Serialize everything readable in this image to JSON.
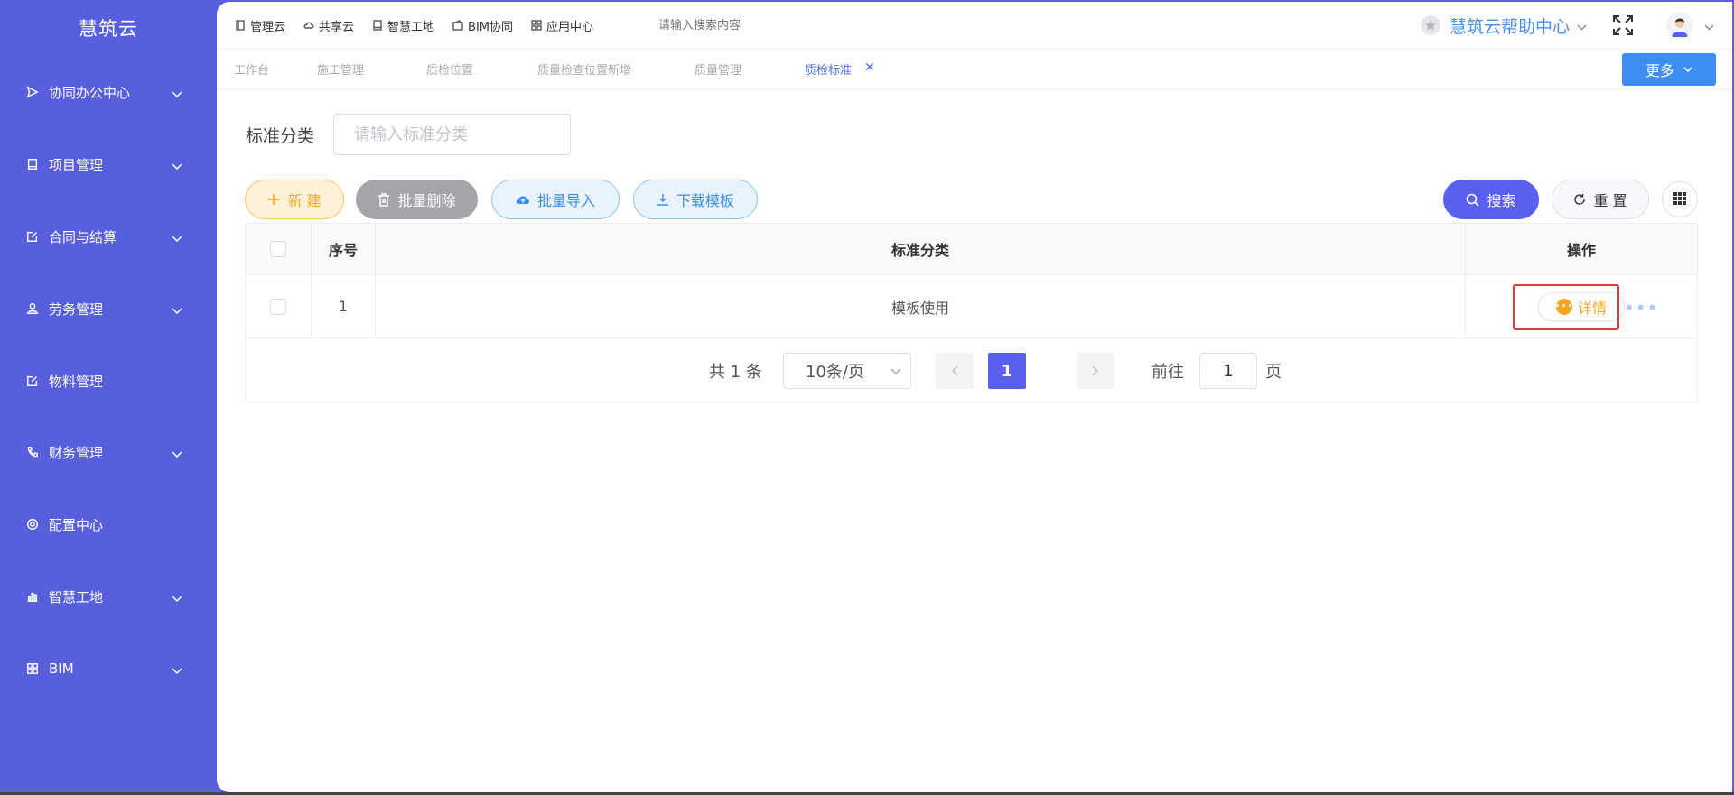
{
  "sidebar": {
    "logo": "慧筑云",
    "items": [
      {
        "label": "协同办公中心",
        "icon": "send-icon",
        "expandable": true
      },
      {
        "label": "项目管理",
        "icon": "book-icon",
        "expandable": true
      },
      {
        "label": "合同与结算",
        "icon": "edit-doc-icon",
        "expandable": true
      },
      {
        "label": "劳务管理",
        "icon": "user-icon",
        "expandable": true
      },
      {
        "label": "物料管理",
        "icon": "edit-doc-icon",
        "expandable": false
      },
      {
        "label": "财务管理",
        "icon": "phone-icon",
        "expandable": true
      },
      {
        "label": "配置中心",
        "icon": "gear-icon",
        "expandable": false
      },
      {
        "label": "智慧工地",
        "icon": "bar-chart-icon",
        "expandable": true
      },
      {
        "label": "BIM",
        "icon": "grid-icon",
        "expandable": true
      }
    ]
  },
  "topnav": {
    "items": [
      {
        "label": "管理云",
        "icon": "doc-icon"
      },
      {
        "label": "共享云",
        "icon": "cloud-icon"
      },
      {
        "label": "智慧工地",
        "icon": "book-icon"
      },
      {
        "label": "BIM协同",
        "icon": "wallet-icon"
      },
      {
        "label": "应用中心",
        "icon": "grid-icon"
      }
    ],
    "search_placeholder": "请输入搜索内容",
    "help_label": "慧筑云帮助中心"
  },
  "tabs": [
    {
      "label": "工作台",
      "active": false
    },
    {
      "label": "施工管理",
      "active": false
    },
    {
      "label": "质检位置",
      "active": false
    },
    {
      "label": "质量检查位置新增",
      "active": false
    },
    {
      "label": "质量管理",
      "active": false
    },
    {
      "label": "质检标准",
      "active": true
    }
  ],
  "tab_close": "✕",
  "more_label": "更多",
  "filter": {
    "label": "标准分类",
    "placeholder": "请输入标准分类"
  },
  "actions": {
    "new_label": "新 建",
    "delete_label": "批量删除",
    "import_label": "批量导入",
    "template_label": "下载模板",
    "search_label": "搜索",
    "reset_label": "重 置"
  },
  "table": {
    "headers": {
      "no": "序号",
      "category": "标准分类",
      "operation": "操作"
    },
    "rows": [
      {
        "no": "1",
        "category": "模板使用",
        "detail_label": "详情"
      }
    ]
  },
  "pager": {
    "total": "共 1 条",
    "page_size": "10条/页",
    "current_page": "1",
    "goto_label": "前往",
    "goto_value": "1",
    "page_suffix": "页"
  },
  "colors": {
    "sidebar": "#575fdc",
    "primary": "#5a5ff0",
    "accent_blue": "#3d8ef0",
    "warning": "#f5a623",
    "highlight": "#e53935"
  }
}
